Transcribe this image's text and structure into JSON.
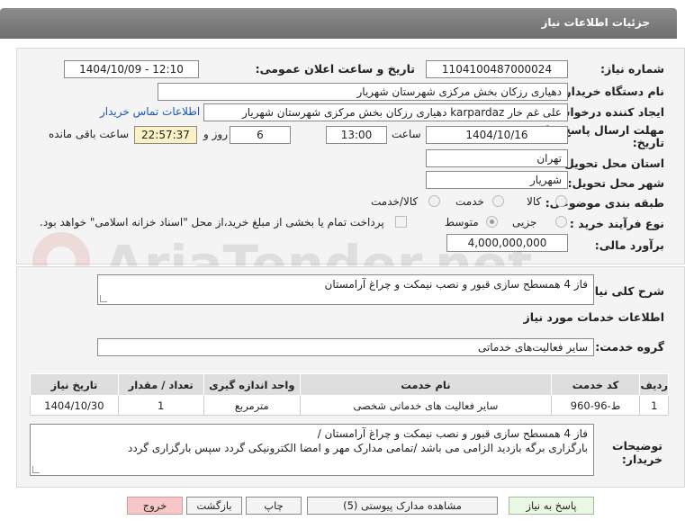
{
  "header": {
    "title": "جزئیات اطلاعات نیاز"
  },
  "fields": {
    "need_number_label": "شماره نیاز:",
    "need_number": "1104100487000024",
    "announce_label": "تاریخ و ساعت اعلان عمومی:",
    "announce_value": "1404/10/09 - 12:10",
    "buyer_org_label": "نام دستگاه خریدار:",
    "buyer_org": "دهیاری رزکان بخش مرکزی شهرستان شهریار",
    "creator_label": "ایجاد کننده درخواست:",
    "creator": "علی غم خار karpardaz دهیاری رزکان بخش مرکزی شهرستان شهریار",
    "contact_link": "اطلاعات تماس خریدار",
    "deadline_label_line1": "مهلت ارسال پاسخ: تا",
    "deadline_label_line2": "تاریخ:",
    "deadline_date": "1404/10/16",
    "time_label": "ساعت",
    "deadline_time": "13:00",
    "days_value": "6",
    "days_label": "روز و",
    "remaining_time": "22:57:37",
    "remaining_label": "ساعت باقی مانده",
    "province_label": "استان محل تحویل:",
    "province": "تهران",
    "city_label": "شهر محل تحویل:",
    "city": "شهریار",
    "category_label": "طبقه بندی موضوعی:",
    "category_options": [
      "کالا",
      "خدمت",
      "کالا/خدمت"
    ],
    "process_label": "نوع فرآیند خرید :",
    "process_options": [
      "جزیی",
      "متوسط"
    ],
    "payment_note": "پرداخت تمام یا بخشی از مبلغ خرید،از محل \"اسناد خزانه اسلامی\" خواهد بود.",
    "estimate_label": "برآورد مالی:",
    "estimate": "4,000,000,000"
  },
  "summary": {
    "label": "شرح کلی نیاز:",
    "text": "فاز 4 همسطح سازی قبور و نصب نیمکت و چراغ آرامستان"
  },
  "services": {
    "section_title": "اطلاعات خدمات مورد نیاز",
    "group_label": "گروه خدمت:",
    "group_value": "سایر فعالیت‌های خدماتی",
    "table": {
      "headers": [
        "ردیف",
        "کد خدمت",
        "نام خدمت",
        "واحد اندازه گیری",
        "تعداد / مقدار",
        "تاریخ نیاز"
      ],
      "rows": [
        [
          "1",
          "ط-96-960",
          "سایر فعالیت های خدماتی شخصی",
          "مترمربع",
          "1",
          "1404/10/30"
        ]
      ]
    }
  },
  "buyer_notes": {
    "label_line1": "توضیحات",
    "label_line2": "خریدار:",
    "line1": "فاز 4 همسطح سازی قبور و نصب نیمکت و چراغ آرامستان /",
    "line2": "بارگزاری برگه بازدید الزامی می باشد /تمامی مدارک مهر و امضا الکترونیکی گردد سپس بارگزاری گردد"
  },
  "buttons": {
    "reply": "پاسخ به نیاز",
    "attachments": "مشاهده مدارک پیوستی (5)",
    "print": "چاپ",
    "back": "بازگشت",
    "exit": "خروج"
  },
  "watermark": {
    "text": "AriaTender.net"
  },
  "colors": {
    "header_bg": "#7d7d7d",
    "link": "#1a56b3",
    "remaining_bg": "#fbf3c6",
    "exit_bg": "#f7c6c6",
    "reply_bg": "#e9f7e4"
  }
}
